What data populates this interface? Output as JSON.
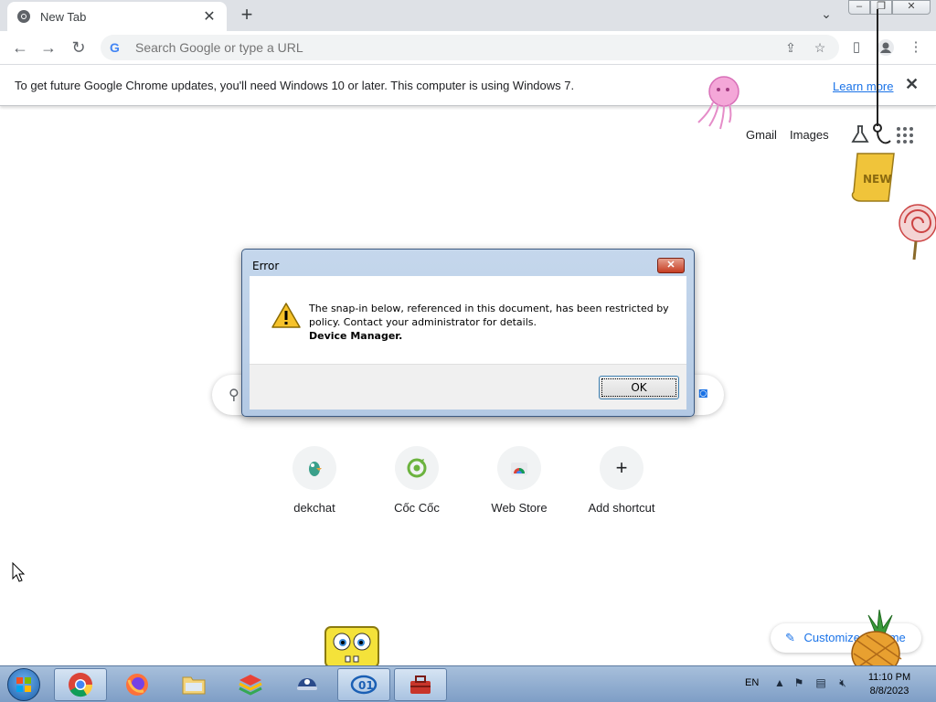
{
  "browser": {
    "tab_title": "New Tab",
    "new_tab_label": "+",
    "omnibox_placeholder": "Search Google or type a URL"
  },
  "infobar": {
    "message": "To get future Google Chrome updates, you'll need Windows 10 or later. This computer is using Windows 7.",
    "link": "Learn more"
  },
  "ntp": {
    "links": [
      "Gmail",
      "Images"
    ],
    "shortcuts": [
      {
        "label": "dekchat",
        "icon": "dekchat-icon"
      },
      {
        "label": "Cốc Cốc",
        "icon": "coccoc-icon"
      },
      {
        "label": "Web Store",
        "icon": "webstore-icon"
      },
      {
        "label": "Add shortcut",
        "icon": "plus-icon"
      }
    ],
    "customize_label": "Customize Chrome"
  },
  "dialog": {
    "title": "Error",
    "message_line1": "The snap-in below, referenced in this document, has been restricted by",
    "message_line2": "policy. Contact your administrator for details.",
    "message_line3": "Device Manager.",
    "ok_label": "OK"
  },
  "taskbar": {
    "language": "EN",
    "time": "11:10 PM",
    "date": "8/8/2023"
  },
  "colors": {
    "accent": "#1a73e8",
    "taskbar": "#8fadd2",
    "dialog_close": "#c63d22"
  }
}
